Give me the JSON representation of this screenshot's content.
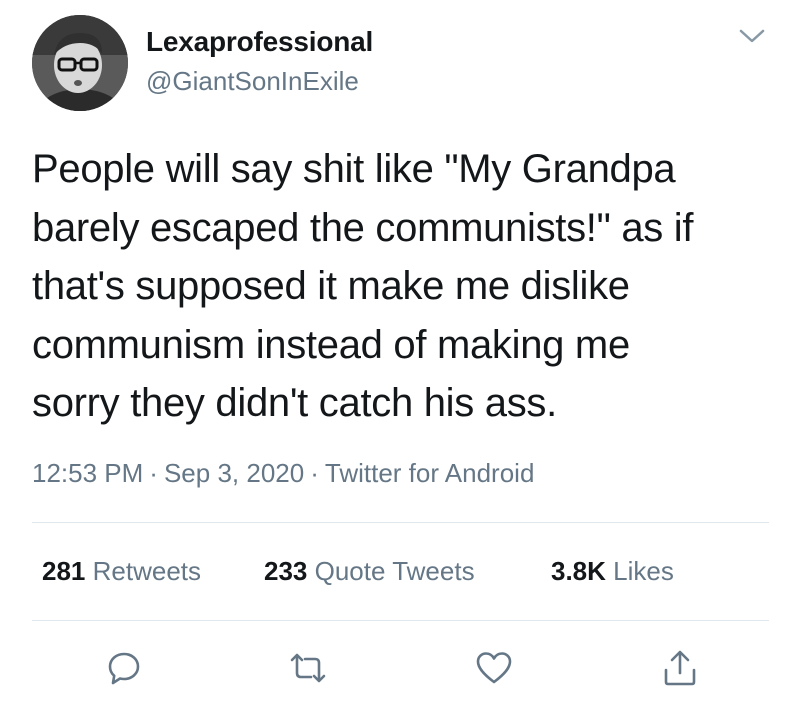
{
  "author": {
    "display_name": "Lexaprofessional",
    "handle": "@GiantSonInExile",
    "avatar_icon": "profile-photo"
  },
  "tweet": {
    "lines": [
      "People will say shit like \"My Grandpa",
      "barely escaped the communists!\" as if",
      "that's supposed it make me dislike",
      "communism instead of making me",
      "sorry they didn't catch his ass."
    ]
  },
  "meta": {
    "time": "12:53 PM",
    "separator": "·",
    "date": "Sep 3, 2020",
    "source": "Twitter for Android"
  },
  "stats": {
    "retweets_count": "281",
    "retweets_label": "Retweets",
    "quotes_count": "233",
    "quotes_label": "Quote Tweets",
    "likes_count": "3.8K",
    "likes_label": "Likes"
  },
  "actions": {
    "icons": [
      "reply-icon",
      "retweet-icon",
      "like-icon",
      "share-icon"
    ]
  },
  "colors": {
    "text_primary": "#14171a",
    "text_secondary": "#657786",
    "divider": "#e1e8ed"
  }
}
